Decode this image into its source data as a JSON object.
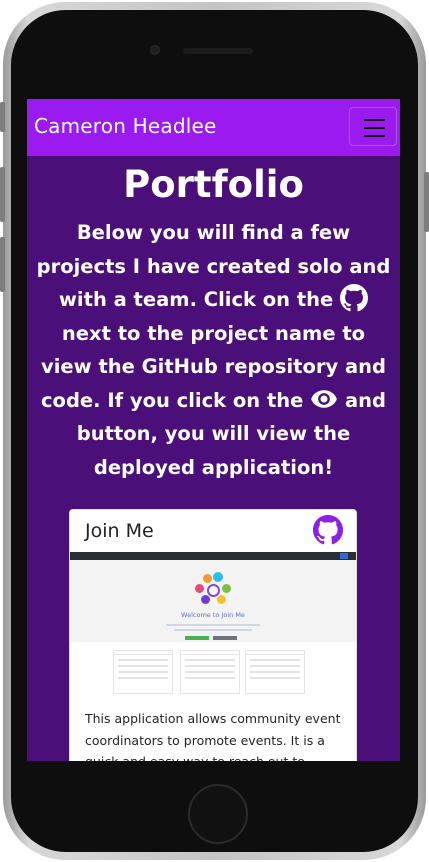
{
  "navbar": {
    "brand": "Cameron Headlee"
  },
  "page": {
    "title": "Portfolio",
    "intro_parts": [
      "Below you will find a few projects I have created solo and with a team. Click on the ",
      " next to the project name to view the GitHub repository and code. If you click on the ",
      " and button, you will view the deployed application!"
    ]
  },
  "project_card": {
    "title": "Join Me",
    "screenshot_heading": "Welcome to Join Me",
    "description": "This application allows community event coordinators to promote events. It is a quick and easy way to reach out to"
  },
  "colors": {
    "navbar": "#9a1af0",
    "background": "#4b0f7a",
    "github_icon": "#8e1fe6"
  },
  "icons": [
    "github-icon",
    "eye-icon",
    "github-icon",
    "menu-icon"
  ]
}
